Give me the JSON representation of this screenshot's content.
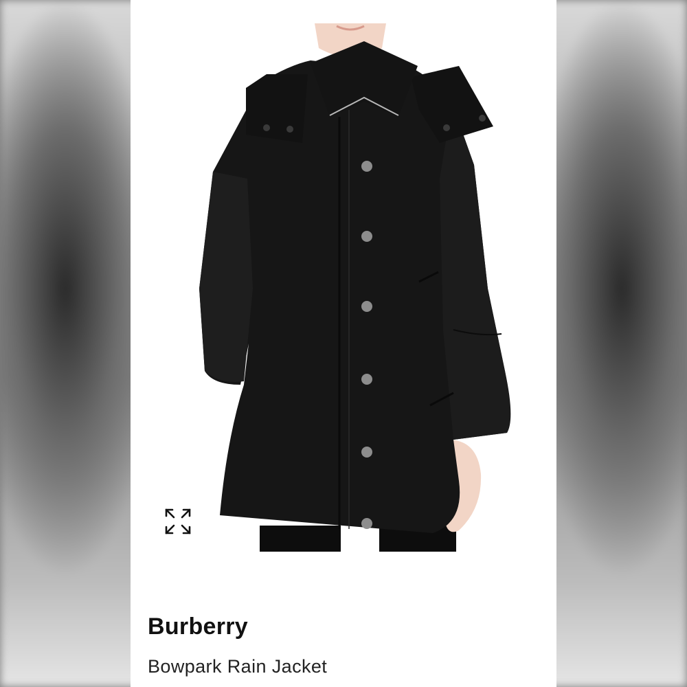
{
  "product": {
    "brand": "Burberry",
    "name": "Bowpark Rain Jacket"
  },
  "image": {
    "subject": "black-hooded-rain-jacket",
    "garment_color": "#151515",
    "skin_color": "#f1d3c3"
  },
  "controls": {
    "expand_icon": "expand-arrows-icon"
  }
}
